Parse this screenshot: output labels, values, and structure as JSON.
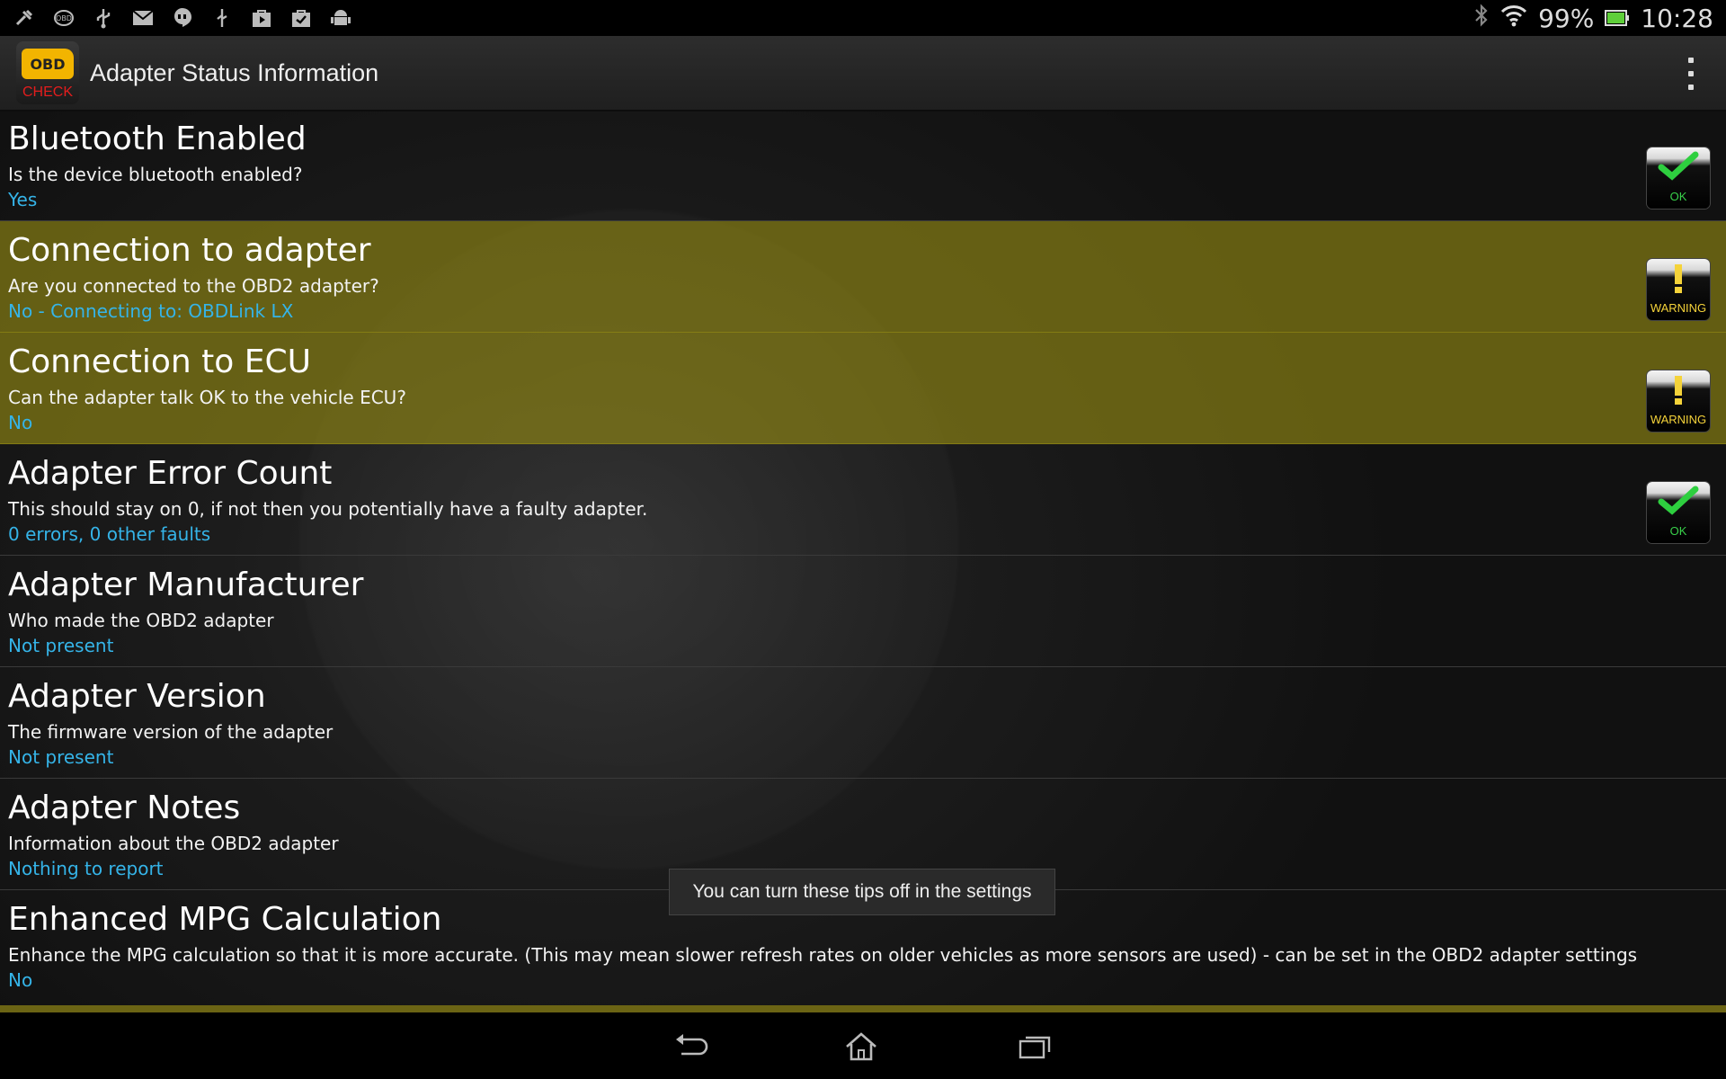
{
  "status_bar": {
    "notification_icons": [
      "tools-icon",
      "obd-icon",
      "usb-icon",
      "gmail-icon",
      "hangouts-icon",
      "usb-debug-icon",
      "play-store-icon",
      "briefcase-check-icon",
      "android-icon"
    ],
    "battery_percent": "99%",
    "time": "10:28"
  },
  "action_bar": {
    "app_icon_top": "OBD",
    "app_icon_bottom": "CHECK",
    "title": "Adapter Status Information"
  },
  "items": [
    {
      "title": "Bluetooth Enabled",
      "description": "Is the device bluetooth enabled?",
      "value": "Yes",
      "status": "OK",
      "highlight": false
    },
    {
      "title": "Connection to adapter",
      "description": "Are you connected to the OBD2 adapter?",
      "value": "No - Connecting to: OBDLink LX",
      "status": "WARNING",
      "highlight": true
    },
    {
      "title": "Connection to ECU",
      "description": "Can the adapter talk OK to the vehicle ECU?",
      "value": "No",
      "status": "WARNING",
      "highlight": true
    },
    {
      "title": "Adapter Error Count",
      "description": "This should stay on 0, if not then you potentially have a faulty adapter.",
      "value": "0 errors, 0 other faults",
      "status": "OK",
      "highlight": false
    },
    {
      "title": "Adapter Manufacturer",
      "description": "Who made the OBD2 adapter",
      "value": "Not present",
      "status": "",
      "highlight": false
    },
    {
      "title": "Adapter Version",
      "description": "The firmware version of the adapter",
      "value": "Not present",
      "status": "",
      "highlight": false
    },
    {
      "title": "Adapter Notes",
      "description": "Information about the OBD2 adapter",
      "value": "Nothing to report",
      "status": "",
      "highlight": false
    },
    {
      "title": "Enhanced MPG Calculation",
      "description": "Enhance the MPG calculation so that it is more accurate. (This may mean slower refresh rates on older vehicles as more sensors are used) - can be set in the OBD2 adapter settings",
      "value": "No",
      "status": "",
      "highlight": false
    }
  ],
  "toast": "You can turn these tips off in the settings",
  "colors": {
    "value_text": "#35b4e8",
    "warning_row": "#968c14",
    "ok_badge": "#38d04a",
    "warning_badge": "#f5d33a"
  }
}
